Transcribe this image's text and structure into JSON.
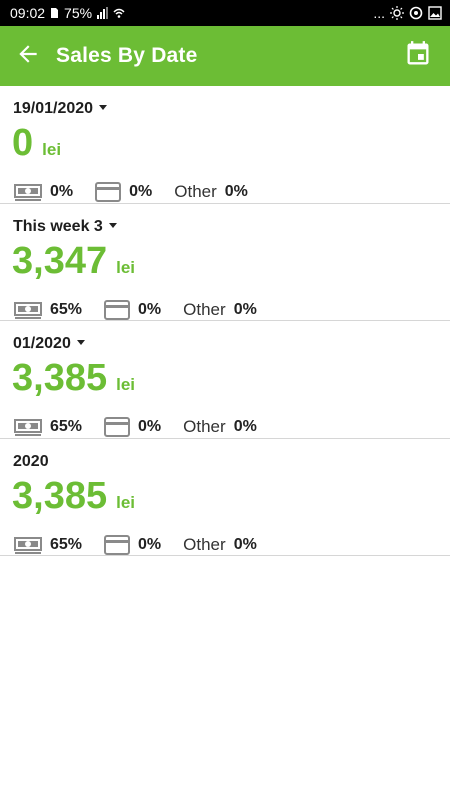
{
  "status_bar": {
    "time": "09:02",
    "battery": "75%",
    "right_dots": "..."
  },
  "app_bar": {
    "title": "Sales By Date",
    "back_icon": "arrow-left-icon",
    "calendar_icon": "calendar-event-icon",
    "background": "#6cbd35"
  },
  "colors": {
    "accent": "#6cbd35",
    "icon_gray": "#8a8a8a"
  },
  "periods": [
    {
      "label": "19/01/2020",
      "has_dropdown": true,
      "amount": "0",
      "currency": "lei",
      "cash_pct": "0%",
      "card_pct": "0%",
      "other_label": "Other",
      "other_pct": "0%"
    },
    {
      "label": "This week 3",
      "has_dropdown": true,
      "amount": "3,347",
      "currency": "lei",
      "cash_pct": "65%",
      "card_pct": "0%",
      "other_label": "Other",
      "other_pct": "0%"
    },
    {
      "label": "01/2020",
      "has_dropdown": true,
      "amount": "3,385",
      "currency": "lei",
      "cash_pct": "65%",
      "card_pct": "0%",
      "other_label": "Other",
      "other_pct": "0%"
    },
    {
      "label": "2020",
      "has_dropdown": false,
      "amount": "3,385",
      "currency": "lei",
      "cash_pct": "65%",
      "card_pct": "0%",
      "other_label": "Other",
      "other_pct": "0%"
    }
  ]
}
